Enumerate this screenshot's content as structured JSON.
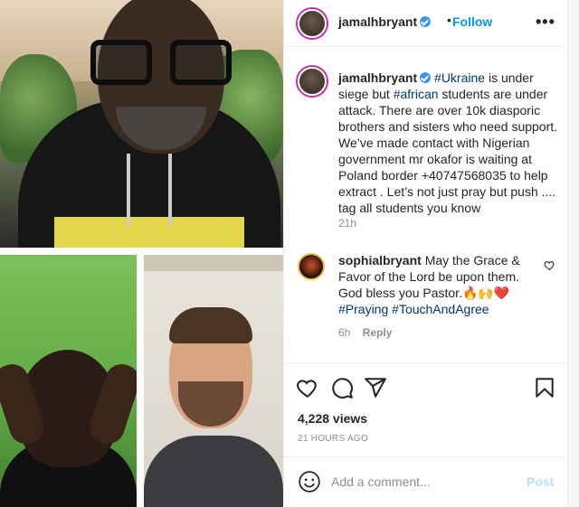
{
  "header": {
    "username": "jamalhbryant",
    "separator": "•",
    "follow_label": "Follow",
    "more_label": "•••"
  },
  "caption": {
    "username": "jamalhbryant",
    "hashtag1": "#Ukraine",
    "text1": " is under siege but ",
    "hashtag2": "#african",
    "text2": " students are under attack. There are over 10k diasporic brothers and sisters who need support. We’ve made contact with Nigerian government mr okafor is waiting at Poland border +40747568035 to help extract . Let’s not just pray but push .... tag all students you know",
    "time": "21h"
  },
  "comment": {
    "username": "sophialbryant",
    "text": "May the Grace & Favor of the Lord be upon them. God bless you Pastor.🔥🙌❤️",
    "hashtag1": "#Praying",
    "hashtag2": "#TouchAndAgree",
    "time": "6h",
    "reply_label": "Reply"
  },
  "stats": {
    "views": "4,228 views",
    "posted_ago": "21 HOURS AGO"
  },
  "add_comment": {
    "placeholder": "Add a comment...",
    "post_label": "Post"
  },
  "icons": {
    "like": "heart-icon",
    "comment": "comment-icon",
    "share": "paper-plane-icon",
    "save": "bookmark-icon",
    "emoji": "smiley-icon"
  },
  "colors": {
    "link": "#00376b",
    "follow": "#0095f6",
    "verified": "#3897f0",
    "muted": "#8e8e8e",
    "post_disabled": "#b2dffc"
  }
}
